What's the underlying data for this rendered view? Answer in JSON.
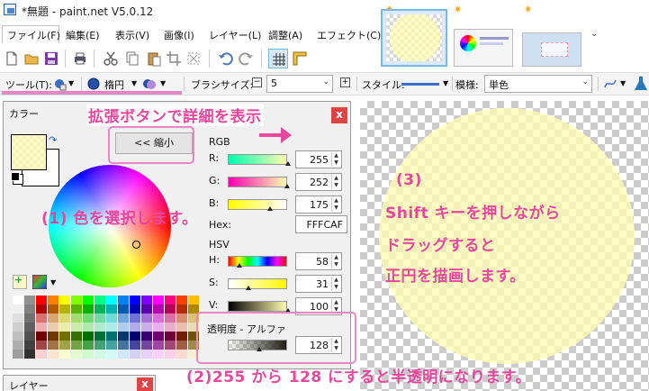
{
  "window": {
    "title": "*無題 - paint.net V5.0.12"
  },
  "menu": {
    "items": [
      "ファイル(F)",
      "編集(E)",
      "表示(V)",
      "画像(I)",
      "レイヤー(L)",
      "調整(A)",
      "エフェクト(C)"
    ]
  },
  "toolbar": {
    "tool_label": "ツール(T):",
    "shape_label": "楕円",
    "brush_size_label": "ブラシサイズ:",
    "brush_size_value": "5",
    "style_label": "スタイル:",
    "pattern_label": "模様:",
    "pattern_value": "単色"
  },
  "colors_panel": {
    "title": "カラー",
    "close": "x",
    "shrink_button": "<< 縮小",
    "primary_color": "#FFFCAF",
    "rgb_label": "RGB",
    "hex_label": "Hex:",
    "hex_value": "FFFCAF",
    "hsv_label": "HSV",
    "alpha_label": "透明度 - アルファ",
    "sliders": {
      "r": {
        "label": "R:",
        "value": "255",
        "fill": 1.0
      },
      "g": {
        "label": "G:",
        "value": "252",
        "fill": 0.988
      },
      "b": {
        "label": "B:",
        "value": "175",
        "fill": 0.686
      },
      "h": {
        "label": "H:",
        "value": "58",
        "fill": 0.161
      },
      "s": {
        "label": "S:",
        "value": "31",
        "fill": 0.31
      },
      "v": {
        "label": "V:",
        "value": "100",
        "fill": 1.0
      },
      "a": {
        "value": "128",
        "fill": 0.5
      }
    }
  },
  "layers_panel": {
    "title": "レイヤー",
    "close": "x"
  },
  "annotations": {
    "expand": "拡張ボタンで詳細を表示",
    "step1": "(1) 色を選択します。",
    "step2": "(2)255 から 128 にすると半透明になります。",
    "step3_num": "(3)",
    "step3_l1": "Shift キーを押しながら",
    "step3_l2": "ドラッグすると",
    "step3_l3": "正円を描画します。"
  }
}
